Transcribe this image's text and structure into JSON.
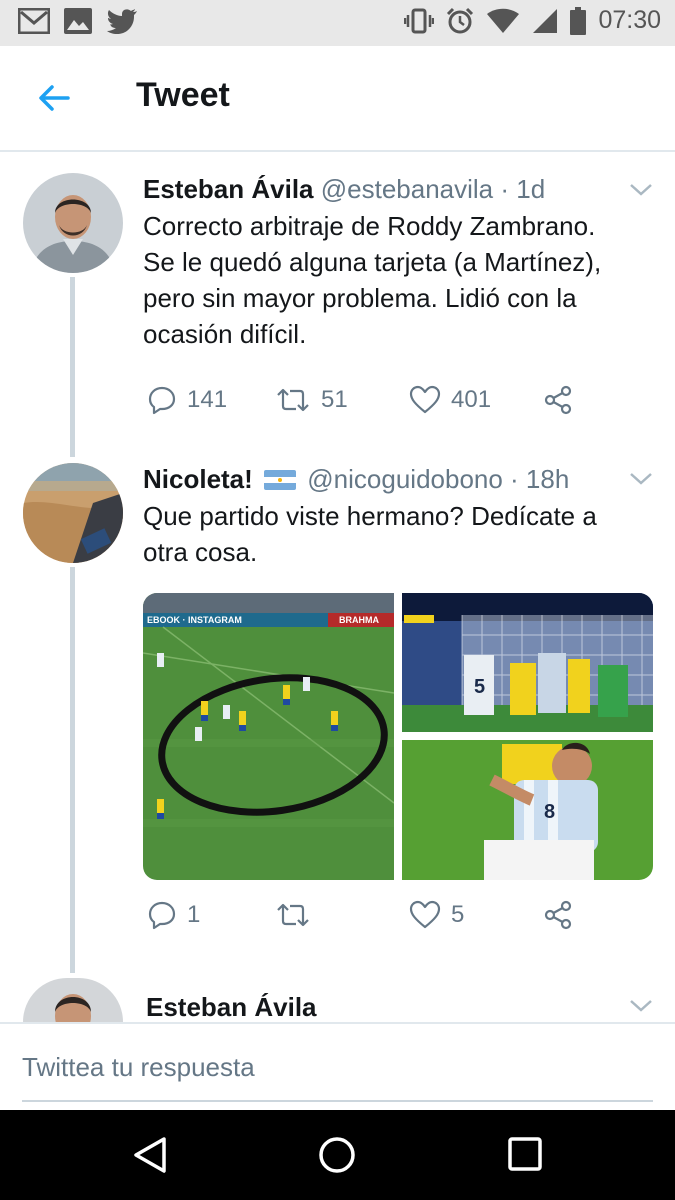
{
  "status_bar": {
    "time": "07:30",
    "left_icons": [
      "gmail-icon",
      "gallery-icon",
      "twitter-icon"
    ],
    "right_icons": [
      "vibrate-icon",
      "alarm-icon",
      "wifi-icon",
      "signal-icon",
      "battery-icon"
    ]
  },
  "header": {
    "title": "Tweet"
  },
  "tweets": [
    {
      "name": "Esteban Ávila",
      "meta": "@estebanavila · 1d",
      "text_lines": [
        "Correcto arbitraje de Roddy Zambrano.",
        "Se le quedó alguna tarjeta (a Martínez),",
        "pero sin mayor problema. Lidió con la",
        "ocasión difícil."
      ],
      "replies": "141",
      "retweets": "51",
      "likes": "401"
    },
    {
      "name": "Nicoleta!",
      "meta": "@nicoguidobono · 18h",
      "text_lines": [
        "Que partido viste hermano? Dedícate a",
        "otra cosa."
      ],
      "replies": "1",
      "retweets": "",
      "likes": "5",
      "media_text": {
        "banner_left": "EBOOK · INSTAGRAM",
        "banner_right": "BRAHMA",
        "player_number_1": "5",
        "player_number_2": "8"
      }
    },
    {
      "name": "Esteban Ávila"
    }
  ],
  "reply": {
    "placeholder": "Twittea tu respuesta"
  },
  "colors": {
    "accent": "#1da1f2",
    "secondary": "#657786",
    "border": "#e1e8ed"
  }
}
